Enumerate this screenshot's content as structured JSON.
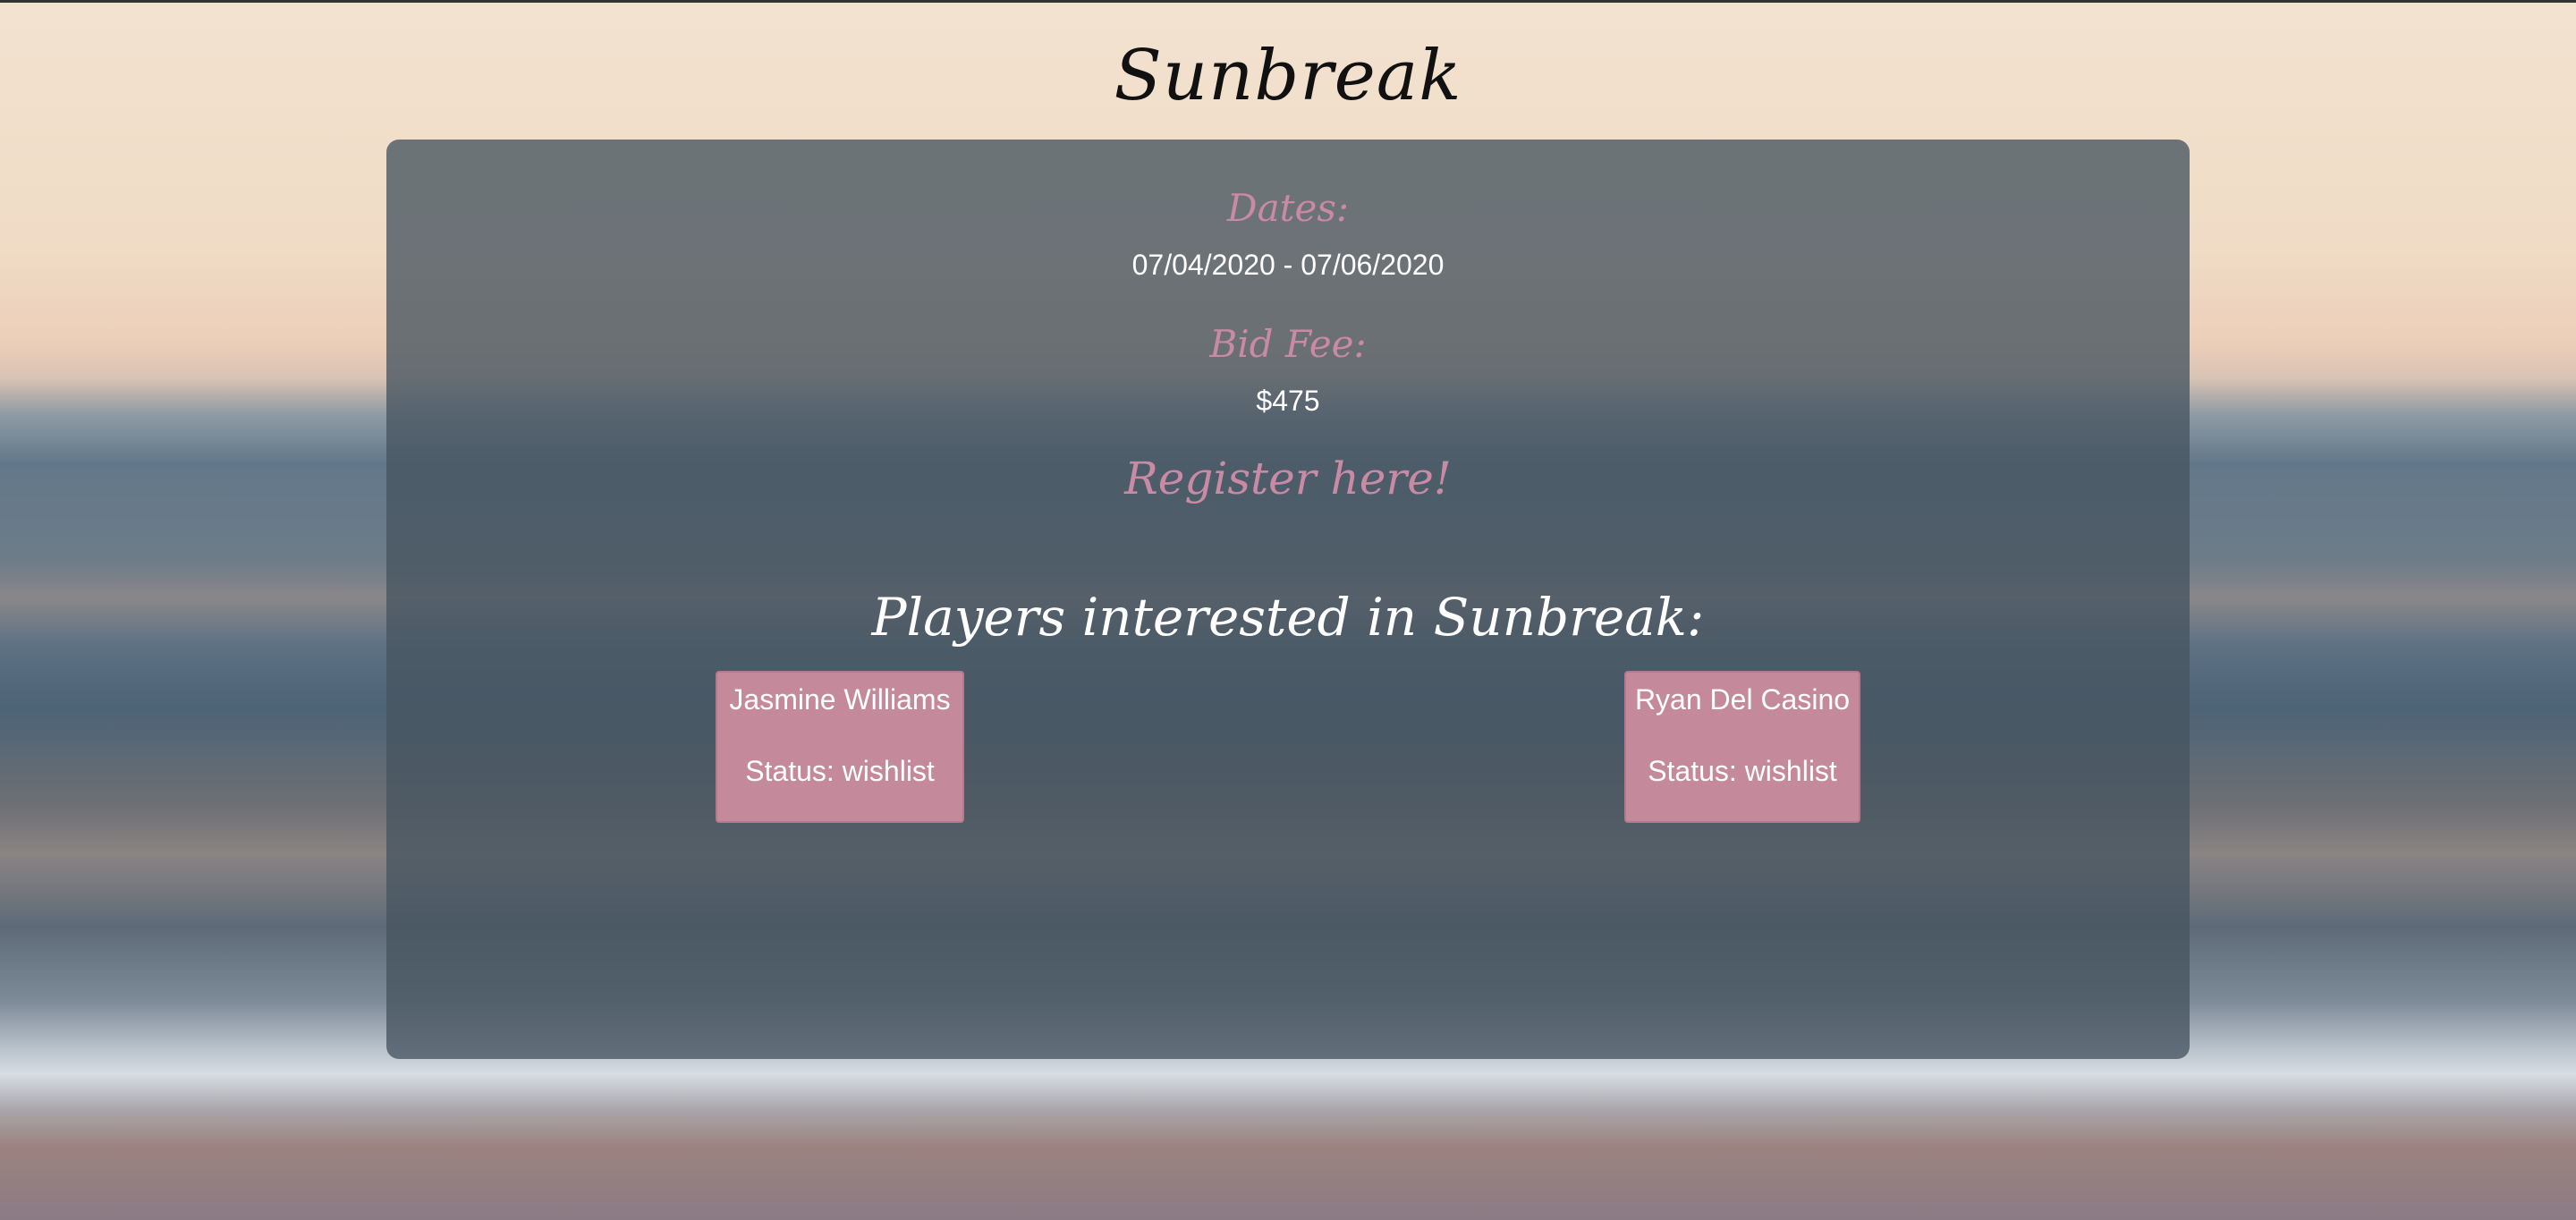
{
  "page": {
    "title": "Sunbreak"
  },
  "event": {
    "dates_label": "Dates:",
    "dates_value": "07/04/2020 - 07/06/2020",
    "bid_fee_label": "Bid Fee:",
    "bid_fee_value": "$475",
    "register_link": "Register here!"
  },
  "players": {
    "heading": "Players interested in Sunbreak:",
    "items": [
      {
        "name": "Jasmine Williams",
        "status": "Status: wishlist"
      },
      {
        "name": "Ryan Del Casino",
        "status": "Status: wishlist"
      }
    ]
  },
  "colors": {
    "accent_pink": "#c98aa3",
    "card_pink": "#c48a9b",
    "panel": "#475460"
  }
}
